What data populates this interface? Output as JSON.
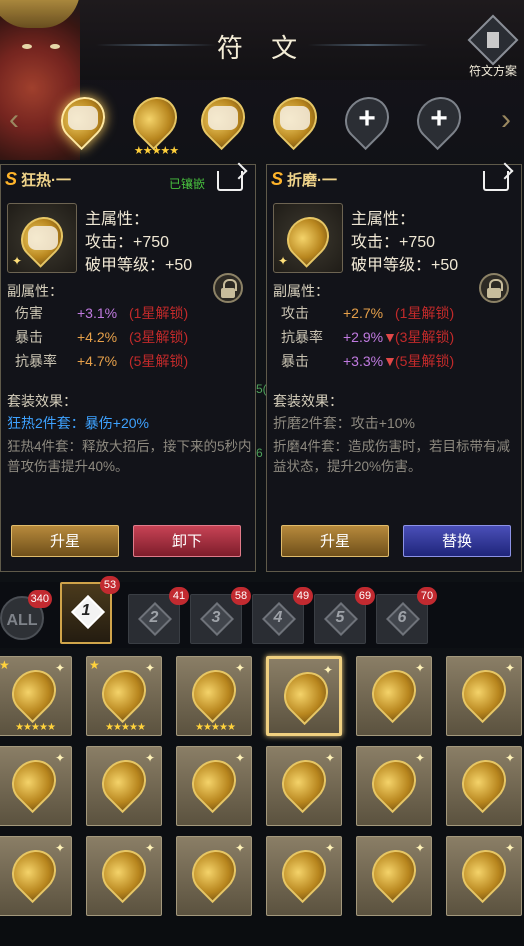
{
  "header": {
    "title": "符 文",
    "plan_label": "符文方案"
  },
  "slots": [
    {
      "state": "filled",
      "selected": true,
      "stars": "★★★★★"
    },
    {
      "state": "filled",
      "selected": false,
      "stars": "★★★★★"
    },
    {
      "state": "filled",
      "selected": false,
      "stars": ""
    },
    {
      "state": "filled",
      "selected": false,
      "stars": ""
    },
    {
      "state": "empty",
      "plus": "+"
    },
    {
      "state": "empty",
      "plus": "+"
    }
  ],
  "left_panel": {
    "name": "狂热·一",
    "equipped": "已镶嵌",
    "main_label": "主属性：",
    "main_stats": [
      "攻击：+750",
      "破甲等级：+50"
    ],
    "sub_label": "副属性：",
    "sub_stats": [
      {
        "name": "伤害",
        "value": "+3.1%",
        "unlock": "(1星解锁)"
      },
      {
        "name": "暴击",
        "value": "+4.2%",
        "unlock": "(3星解锁)"
      },
      {
        "name": "抗暴率",
        "value": "+4.7%",
        "unlock": "(5星解锁)"
      }
    ],
    "set_label": "套装效果：",
    "set2": "狂热2件套：暴伤+20%",
    "set4": "狂热4件套：释放大招后，接下来的5秒内普攻伤害提升40%。",
    "btn1": "升星",
    "btn2": "卸下"
  },
  "right_panel": {
    "name": "折磨·一",
    "main_label": "主属性：",
    "main_stats": [
      "攻击：+750",
      "破甲等级：+50"
    ],
    "sub_label": "副属性：",
    "sub_stats": [
      {
        "name": "攻击",
        "value": "+2.7%",
        "unlock": "(1星解锁)"
      },
      {
        "name": "抗暴率",
        "value": "+2.9%",
        "arrow": "▼",
        "unlock": "(3星解锁)"
      },
      {
        "name": "暴击",
        "value": "+3.3%",
        "arrow": "▼",
        "unlock": "(5星解锁)"
      }
    ],
    "set_label": "套装效果：",
    "set2": "折磨2件套：攻击+10%",
    "set4": "折磨4件套：造成伤害时，若目标带有减益状态，提升20%伤害。",
    "btn1": "升星",
    "btn2": "替换"
  },
  "middle_fragments": [
    "5(",
    "6"
  ],
  "filter_tabs": [
    {
      "label": "ALL",
      "count": "340"
    },
    {
      "label": "1",
      "count": "53",
      "active": true
    },
    {
      "label": "2",
      "count": "41"
    },
    {
      "label": "3",
      "count": "58"
    },
    {
      "label": "4",
      "count": "49"
    },
    {
      "label": "5",
      "count": "69"
    },
    {
      "label": "6",
      "count": "70"
    }
  ],
  "grid_cells": [
    {
      "stars": "★★★★★",
      "star1": true
    },
    {
      "stars": "★★★★★",
      "star1": true
    },
    {
      "stars": "★★★★★",
      "star1": false
    },
    {
      "stars": "",
      "selected": true
    },
    {
      "stars": ""
    },
    {
      "stars": ""
    },
    {
      "stars": ""
    },
    {
      "stars": ""
    },
    {
      "stars": ""
    },
    {
      "stars": ""
    },
    {
      "stars": ""
    },
    {
      "stars": ""
    },
    {
      "stars": ""
    },
    {
      "stars": ""
    },
    {
      "stars": ""
    },
    {
      "stars": ""
    },
    {
      "stars": ""
    },
    {
      "stars": ""
    }
  ],
  "colors": {
    "gold": "#f0d48a",
    "equipped_green": "#48c23e",
    "stat_orange": "#e6a04a",
    "stat_purple": "#c07ae0",
    "unlock_red": "#c22a2a",
    "set_blue": "#3ea2ff"
  }
}
